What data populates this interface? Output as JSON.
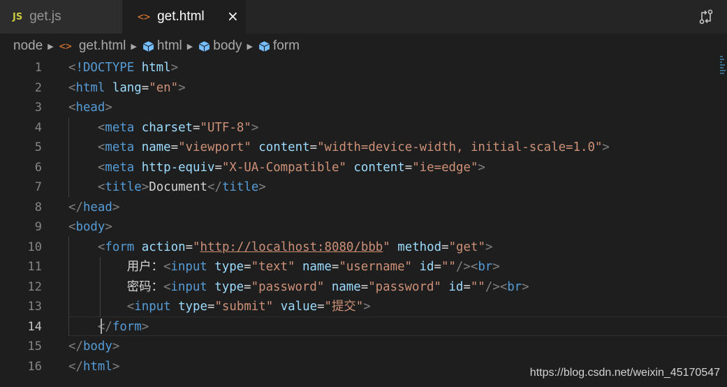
{
  "tabs": [
    {
      "icon": "JS",
      "label": "get.js",
      "active": false
    },
    {
      "icon": "<>",
      "label": "get.html",
      "active": true,
      "close": "×"
    }
  ],
  "breadcrumb": [
    {
      "icon": "folder",
      "label": "node"
    },
    {
      "icon": "<>",
      "label": "get.html"
    },
    {
      "icon": "cube-icon",
      "label": "html"
    },
    {
      "icon": "cube-icon",
      "label": "body"
    },
    {
      "icon": "cube-icon",
      "label": "form"
    }
  ],
  "editor": {
    "current_line": 14,
    "line_numbers": [
      "1",
      "2",
      "3",
      "4",
      "5",
      "6",
      "7",
      "8",
      "9",
      "10",
      "11",
      "12",
      "13",
      "14",
      "15",
      "16"
    ],
    "lines": [
      [
        [
          "pun",
          "<"
        ],
        [
          "tag",
          "!DOCTYPE "
        ],
        [
          "attr",
          "html"
        ],
        [
          "pun",
          ">"
        ]
      ],
      [
        [
          "pun",
          "<"
        ],
        [
          "tag",
          "html "
        ],
        [
          "attr",
          "lang"
        ],
        [
          "txt",
          "="
        ],
        [
          "str",
          "\"en\""
        ],
        [
          "pun",
          ">"
        ]
      ],
      [
        [
          "pun",
          "<"
        ],
        [
          "tag",
          "head"
        ],
        [
          "pun",
          ">"
        ]
      ],
      [
        [
          "txt",
          "    "
        ],
        [
          "pun",
          "<"
        ],
        [
          "tag",
          "meta "
        ],
        [
          "attr",
          "charset"
        ],
        [
          "txt",
          "="
        ],
        [
          "str",
          "\"UTF-8\""
        ],
        [
          "pun",
          ">"
        ]
      ],
      [
        [
          "txt",
          "    "
        ],
        [
          "pun",
          "<"
        ],
        [
          "tag",
          "meta "
        ],
        [
          "attr",
          "name"
        ],
        [
          "txt",
          "="
        ],
        [
          "str",
          "\"viewport\""
        ],
        [
          "txt",
          " "
        ],
        [
          "attr",
          "content"
        ],
        [
          "txt",
          "="
        ],
        [
          "str",
          "\"width=device-width, initial-scale=1.0\""
        ],
        [
          "pun",
          ">"
        ]
      ],
      [
        [
          "txt",
          "    "
        ],
        [
          "pun",
          "<"
        ],
        [
          "tag",
          "meta "
        ],
        [
          "attr",
          "http-equiv"
        ],
        [
          "txt",
          "="
        ],
        [
          "str",
          "\"X-UA-Compatible\""
        ],
        [
          "txt",
          " "
        ],
        [
          "attr",
          "content"
        ],
        [
          "txt",
          "="
        ],
        [
          "str",
          "\"ie=edge\""
        ],
        [
          "pun",
          ">"
        ]
      ],
      [
        [
          "txt",
          "    "
        ],
        [
          "pun",
          "<"
        ],
        [
          "tag",
          "title"
        ],
        [
          "pun",
          ">"
        ],
        [
          "txt",
          "Document"
        ],
        [
          "pun",
          "</"
        ],
        [
          "tag",
          "title"
        ],
        [
          "pun",
          ">"
        ]
      ],
      [
        [
          "pun",
          "</"
        ],
        [
          "tag",
          "head"
        ],
        [
          "pun",
          ">"
        ]
      ],
      [
        [
          "pun",
          "<"
        ],
        [
          "tag",
          "body"
        ],
        [
          "pun",
          ">"
        ]
      ],
      [
        [
          "txt",
          "    "
        ],
        [
          "pun",
          "<"
        ],
        [
          "tag",
          "form "
        ],
        [
          "attr",
          "action"
        ],
        [
          "txt",
          "="
        ],
        [
          "str",
          "\""
        ],
        [
          "url",
          "http://localhost:8080/bbb"
        ],
        [
          "str",
          "\""
        ],
        [
          "txt",
          " "
        ],
        [
          "attr",
          "method"
        ],
        [
          "txt",
          "="
        ],
        [
          "str",
          "\"get\""
        ],
        [
          "pun",
          ">"
        ]
      ],
      [
        [
          "txt",
          "        用户："
        ],
        [
          "pun",
          "<"
        ],
        [
          "tag",
          "input "
        ],
        [
          "attr",
          "type"
        ],
        [
          "txt",
          "="
        ],
        [
          "str",
          "\"text\""
        ],
        [
          "txt",
          " "
        ],
        [
          "attr",
          "name"
        ],
        [
          "txt",
          "="
        ],
        [
          "str",
          "\"username\""
        ],
        [
          "txt",
          " "
        ],
        [
          "attr",
          "id"
        ],
        [
          "txt",
          "="
        ],
        [
          "str",
          "\"\""
        ],
        [
          "pun",
          "/><"
        ],
        [
          "tag",
          "br"
        ],
        [
          "pun",
          ">"
        ]
      ],
      [
        [
          "txt",
          "        密码："
        ],
        [
          "pun",
          "<"
        ],
        [
          "tag",
          "input "
        ],
        [
          "attr",
          "type"
        ],
        [
          "txt",
          "="
        ],
        [
          "str",
          "\"password\""
        ],
        [
          "txt",
          " "
        ],
        [
          "attr",
          "name"
        ],
        [
          "txt",
          "="
        ],
        [
          "str",
          "\"password\""
        ],
        [
          "txt",
          " "
        ],
        [
          "attr",
          "id"
        ],
        [
          "txt",
          "="
        ],
        [
          "str",
          "\"\""
        ],
        [
          "pun",
          "/><"
        ],
        [
          "tag",
          "br"
        ],
        [
          "pun",
          ">"
        ]
      ],
      [
        [
          "txt",
          "        "
        ],
        [
          "pun",
          "<"
        ],
        [
          "tag",
          "input "
        ],
        [
          "attr",
          "type"
        ],
        [
          "txt",
          "="
        ],
        [
          "str",
          "\"submit\""
        ],
        [
          "txt",
          " "
        ],
        [
          "attr",
          "value"
        ],
        [
          "txt",
          "="
        ],
        [
          "str",
          "\"提交\""
        ],
        [
          "pun",
          ">"
        ]
      ],
      [
        [
          "txt",
          "    "
        ],
        [
          "pun",
          "</"
        ],
        [
          "tag",
          "form"
        ],
        [
          "pun",
          ">"
        ]
      ],
      [
        [
          "pun",
          "</"
        ],
        [
          "tag",
          "body"
        ],
        [
          "pun",
          ">"
        ]
      ],
      [
        [
          "pun",
          "</"
        ],
        [
          "tag",
          "html"
        ],
        [
          "pun",
          ">"
        ]
      ]
    ]
  },
  "watermark": "https://blog.csdn.net/weixin_45170547",
  "colors": {
    "background": "#1e1e1e",
    "tag": "#569cd6",
    "attribute": "#9cdcfe",
    "string": "#ce9178"
  }
}
